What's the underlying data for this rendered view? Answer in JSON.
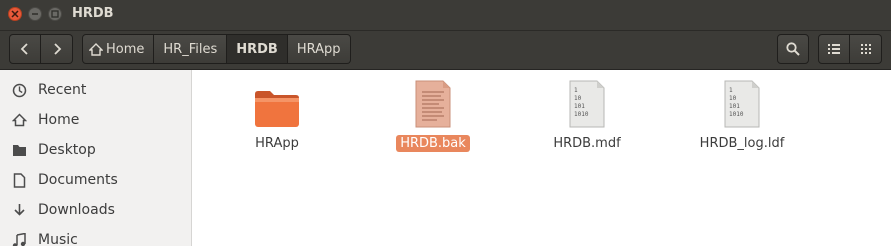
{
  "window": {
    "title": "HRDB"
  },
  "toolbar": {
    "back_icon": "chevron-left-icon",
    "forward_icon": "chevron-right-icon",
    "breadcrumbs": [
      "Home",
      "HR_Files",
      "HRDB",
      "HRApp"
    ],
    "active_crumb": "HRDB",
    "search_icon": "search-icon",
    "list_view_icon": "list-view-icon",
    "grid_view_icon": "grid-view-icon"
  },
  "sidebar": {
    "items": [
      {
        "label": "Recent",
        "icon": "clock-icon"
      },
      {
        "label": "Home",
        "icon": "home-icon"
      },
      {
        "label": "Desktop",
        "icon": "folder-icon"
      },
      {
        "label": "Documents",
        "icon": "document-icon"
      },
      {
        "label": "Downloads",
        "icon": "download-icon"
      },
      {
        "label": "Music",
        "icon": "music-icon"
      }
    ]
  },
  "files": [
    {
      "name": "HRApp",
      "icon": "folder-icon",
      "selected": false
    },
    {
      "name": "HRDB.bak",
      "icon": "text-file-icon",
      "selected": true
    },
    {
      "name": "HRDB.mdf",
      "icon": "binary-file-icon",
      "selected": false
    },
    {
      "name": "HRDB_log.ldf",
      "icon": "binary-file-icon",
      "selected": false
    }
  ],
  "colors": {
    "titlebar": "#3c3b37",
    "close_button": "#e8593a",
    "selection": "#e9875d",
    "folder": "#f0743e",
    "sidebar": "#f2f1f0"
  }
}
